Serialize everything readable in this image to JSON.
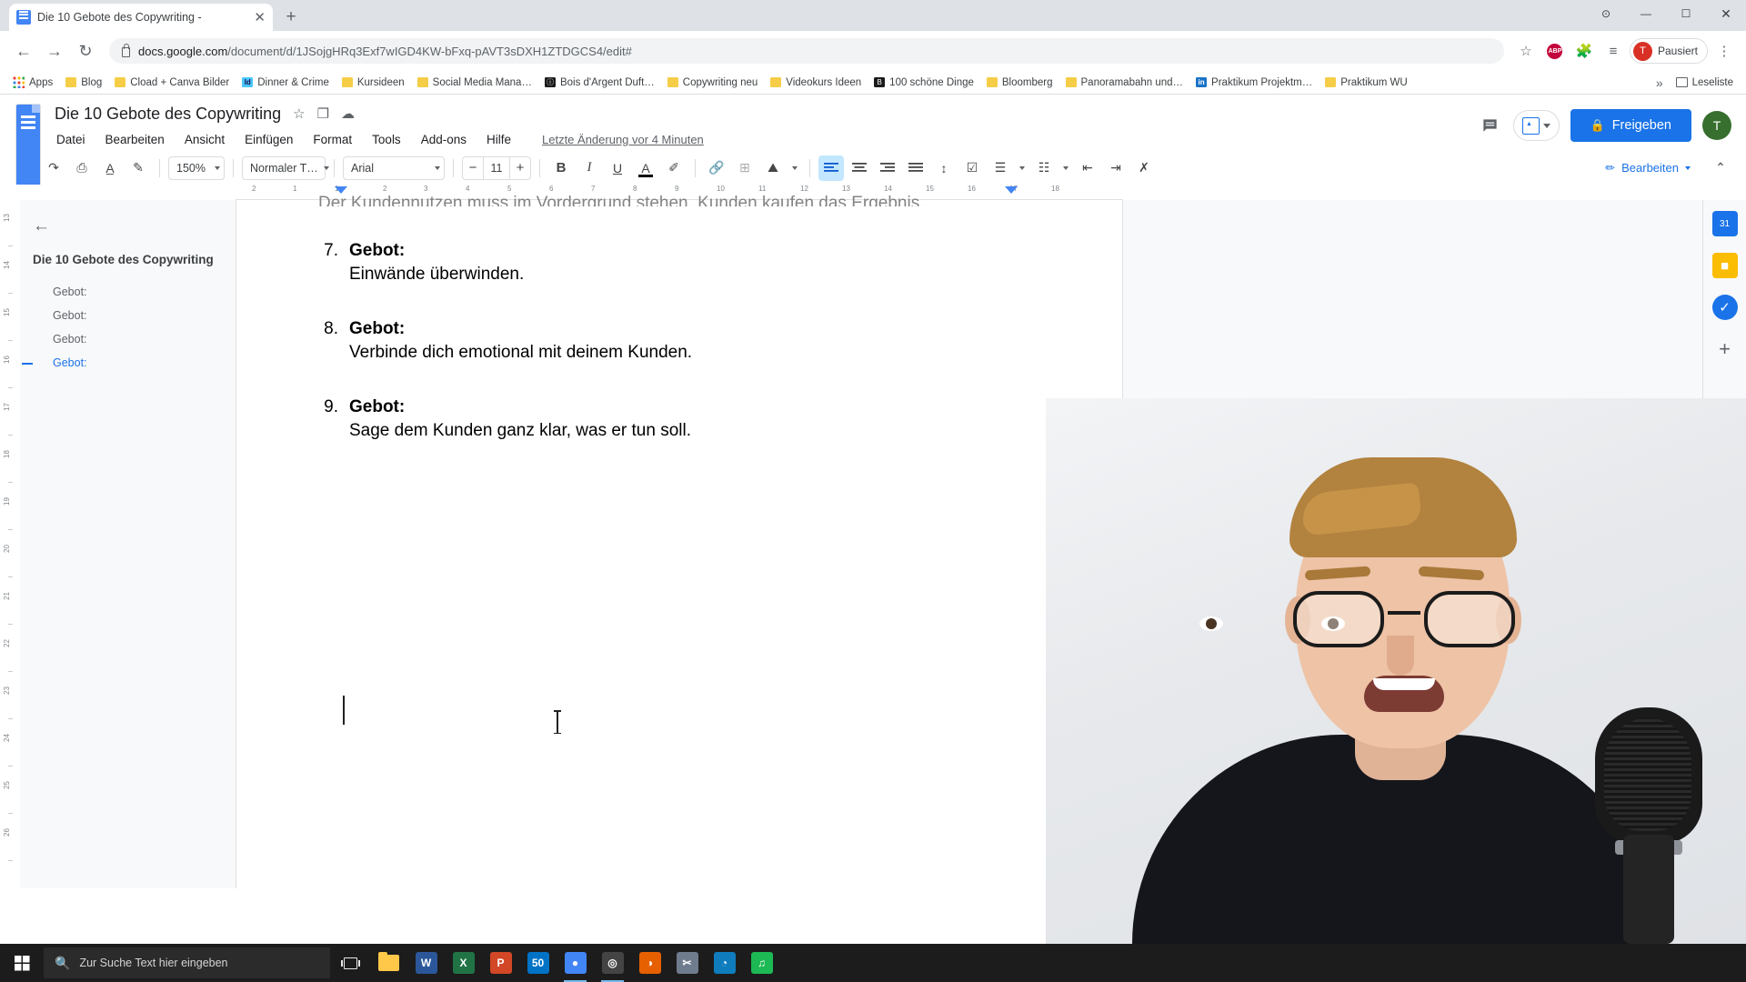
{
  "browser": {
    "tab": {
      "title": "Die 10 Gebote des Copywriting -",
      "close_label": "✕",
      "favicon": "google-docs-favicon"
    },
    "new_tab_label": "+",
    "nav": {
      "back": "←",
      "forward": "→",
      "reload": "↻"
    },
    "url_prefix": "docs.google.com",
    "url_suffix": "/document/d/1JSojgHRq3Exf7wIGD4KW-bFxq-pAVT3sDXH1ZTDGCS4/edit#",
    "omnibox_icons": [
      {
        "name": "bookmark-star-icon",
        "glyph": "☆"
      },
      {
        "name": "adblock-plus-icon",
        "glyph": "ABP"
      },
      {
        "name": "extensions-puzzle-icon",
        "glyph": "🧩"
      },
      {
        "name": "reading-list-icon",
        "glyph": "≡"
      }
    ],
    "profile": {
      "initial": "T",
      "status": "Pausiert"
    },
    "menu_dots": "⋮",
    "window_controls": {
      "minimize": "—",
      "maximize": "☐",
      "close": "✕",
      "extra": "⊙"
    },
    "bookmarks": [
      {
        "label": "Apps",
        "icon": "apps-grid-icon",
        "style": "apps"
      },
      {
        "label": "Blog",
        "icon": "folder-icon",
        "style": "folder"
      },
      {
        "label": "Cload + Canva Bilder",
        "icon": "folder-icon",
        "style": "folder"
      },
      {
        "label": "Dinner & Crime",
        "icon": "indesign-icon",
        "style": "indesign",
        "glyph": "Id"
      },
      {
        "label": "Kursideen",
        "icon": "folder-icon",
        "style": "folder"
      },
      {
        "label": "Social Media Mana…",
        "icon": "folder-icon",
        "style": "folder"
      },
      {
        "label": "Bois d'Argent Duft…",
        "icon": "site-icon",
        "style": "dark",
        "glyph": "ⓘ"
      },
      {
        "label": "Copywriting neu",
        "icon": "folder-icon",
        "style": "folder"
      },
      {
        "label": "Videokurs Ideen",
        "icon": "folder-icon",
        "style": "folder"
      },
      {
        "label": "100 schöne Dinge",
        "icon": "blogger-icon",
        "style": "dark",
        "glyph": "B"
      },
      {
        "label": "Bloomberg",
        "icon": "folder-icon",
        "style": "folder"
      },
      {
        "label": "Panoramabahn und…",
        "icon": "folder-icon",
        "style": "folder"
      },
      {
        "label": "Praktikum Projektm…",
        "icon": "linkedin-icon",
        "style": "blue",
        "glyph": "in"
      },
      {
        "label": "Praktikum WU",
        "icon": "folder-icon",
        "style": "folder"
      }
    ],
    "bookmarks_overflow": "»",
    "reading_list_label": "Leseliste"
  },
  "docs": {
    "title": "Die 10 Gebote des Copywriting",
    "title_icons": [
      {
        "name": "star-icon",
        "glyph": "☆"
      },
      {
        "name": "move-to-folder-icon",
        "glyph": "❐"
      },
      {
        "name": "cloud-saved-icon",
        "glyph": "☁"
      }
    ],
    "menus": [
      "Datei",
      "Bearbeiten",
      "Ansicht",
      "Einfügen",
      "Format",
      "Tools",
      "Add-ons",
      "Hilfe"
    ],
    "last_edit": "Letzte Änderung vor 4 Minuten",
    "comment_history_icon": "comment-icon",
    "present_label": "present-button",
    "share_label": "Freigeben",
    "share_lock_icon": "🔒",
    "account_initial": "T",
    "accent_blue": "#1a73e8",
    "share_green": "#376f2e"
  },
  "toolbar": {
    "undo": "↶",
    "redo": "↷",
    "print": "⎙",
    "spellcheck": "A̲",
    "paint_format": "✎",
    "zoom": "150%",
    "style": "Normaler T…",
    "font": "Arial",
    "font_size": "11",
    "size_minus": "−",
    "size_plus": "+",
    "bold": "B",
    "italic": "I",
    "underline": "U",
    "text_color": "A",
    "highlight": "✐",
    "link": "🔗",
    "comment": "⊞",
    "image": "⛰",
    "align_left": "≡",
    "align_center": "≡",
    "align_right": "≡",
    "align_justify": "≡",
    "line_spacing": "↕",
    "checklist": "☑",
    "bulleted_list": "☰",
    "numbered_list": "☷",
    "decrease_indent": "⇤",
    "increase_indent": "⇥",
    "clear_formatting": "✗",
    "mode_label": "Bearbeiten",
    "mode_pen": "✏",
    "collapse": "⌃"
  },
  "outline": {
    "back_icon": "←",
    "title": "Die 10 Gebote des Copywriting",
    "items": [
      {
        "label": "Gebot:",
        "active": false
      },
      {
        "label": "Gebot:",
        "active": false
      },
      {
        "label": "Gebot:",
        "active": false
      },
      {
        "label": "Gebot:",
        "active": true
      }
    ]
  },
  "ruler": {
    "horizontal_ticks": [
      "2",
      "1",
      "1",
      "2",
      "3",
      "4",
      "5",
      "6",
      "7",
      "8",
      "9",
      "10",
      "11",
      "12",
      "13",
      "14",
      "15",
      "16",
      "17",
      "18"
    ],
    "vertical_ticks": [
      "13",
      "14",
      "15",
      "16",
      "17",
      "18",
      "19",
      "20",
      "21",
      "22",
      "23",
      "24",
      "25",
      "26"
    ]
  },
  "document": {
    "cut_line": "Der Kundennutzen muss im Vordergrund stehen. Kunden kaufen das Ergebnis.",
    "items": [
      {
        "num": "7.",
        "heading": "Gebot:",
        "body": "Einwände überwinden."
      },
      {
        "num": "8.",
        "heading": "Gebot:",
        "body": "Verbinde dich emotional mit deinem Kunden."
      },
      {
        "num": "9.",
        "heading": "Gebot:",
        "body": "Sage dem Kunden ganz klar, was er tun soll."
      }
    ]
  },
  "side_panel": [
    {
      "name": "google-calendar-icon",
      "glyph": "31"
    },
    {
      "name": "google-keep-icon",
      "glyph": "■"
    },
    {
      "name": "google-tasks-icon",
      "glyph": "✓"
    },
    {
      "name": "add-addon-icon",
      "glyph": "+"
    }
  ],
  "taskbar": {
    "start_icon": "windows-start-icon",
    "search_placeholder": "Zur Suche Text hier eingeben",
    "search_icon": "🔍",
    "task_view_icon": "task-view-icon",
    "apps": [
      {
        "name": "file-explorer-icon",
        "glyph": "",
        "color": "#ffc848",
        "style": "folder",
        "active": false
      },
      {
        "name": "word-icon",
        "glyph": "W",
        "color": "#2b579a",
        "active": false
      },
      {
        "name": "excel-icon",
        "glyph": "X",
        "color": "#217346",
        "active": false
      },
      {
        "name": "powerpoint-icon",
        "glyph": "P",
        "color": "#d24726",
        "active": false
      },
      {
        "name": "outlook-icon",
        "glyph": "50",
        "color": "#0072c6",
        "active": false
      },
      {
        "name": "chrome-icon",
        "glyph": "●",
        "color": "#4285f4",
        "active": true
      },
      {
        "name": "obs-icon",
        "glyph": "◎",
        "color": "#444444",
        "active": true
      },
      {
        "name": "firefox-icon",
        "glyph": "◑",
        "color": "#e66000",
        "active": false
      },
      {
        "name": "snip-icon",
        "glyph": "✂",
        "color": "#6f7c8e",
        "active": false
      },
      {
        "name": "edge-icon",
        "glyph": "◔",
        "color": "#0f7dbd",
        "active": false
      },
      {
        "name": "spotify-icon",
        "glyph": "♫",
        "color": "#1db954",
        "active": false
      }
    ]
  }
}
